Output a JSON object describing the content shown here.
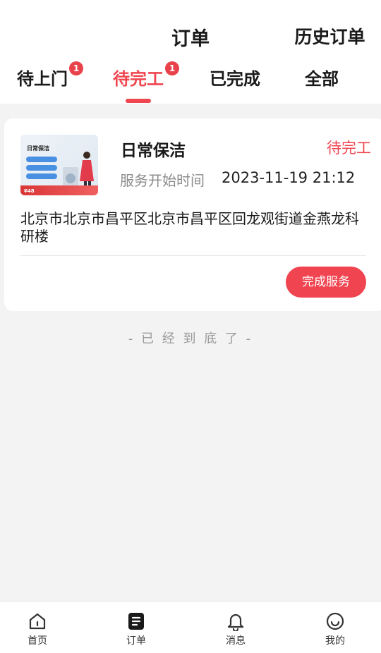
{
  "header": {
    "title": "订单",
    "history_link": "历史订单"
  },
  "tabs": [
    {
      "label": "待上门",
      "badge": "1",
      "active": false
    },
    {
      "label": "待完工",
      "badge": "1",
      "active": true
    },
    {
      "label": "已完成",
      "active": false
    },
    {
      "label": "全部",
      "active": false
    }
  ],
  "accent_color": "#ef4650",
  "order": {
    "thumbnail": {
      "title": "日常保洁",
      "price": "¥48"
    },
    "service_name": "日常保洁",
    "status": "待完工",
    "time_label": "服务开始时间",
    "time_value": "2023-11-19 21:12",
    "address": "北京市北京市昌平区北京市昌平区回龙观街道金燕龙科研楼",
    "action_label": "完成服务"
  },
  "end_text": "- 已 经 到 底 了 -",
  "tabbar": [
    {
      "label": "首页",
      "icon": "home-icon"
    },
    {
      "label": "订单",
      "icon": "order-icon"
    },
    {
      "label": "消息",
      "icon": "bell-icon"
    },
    {
      "label": "我的",
      "icon": "smile-icon"
    }
  ]
}
